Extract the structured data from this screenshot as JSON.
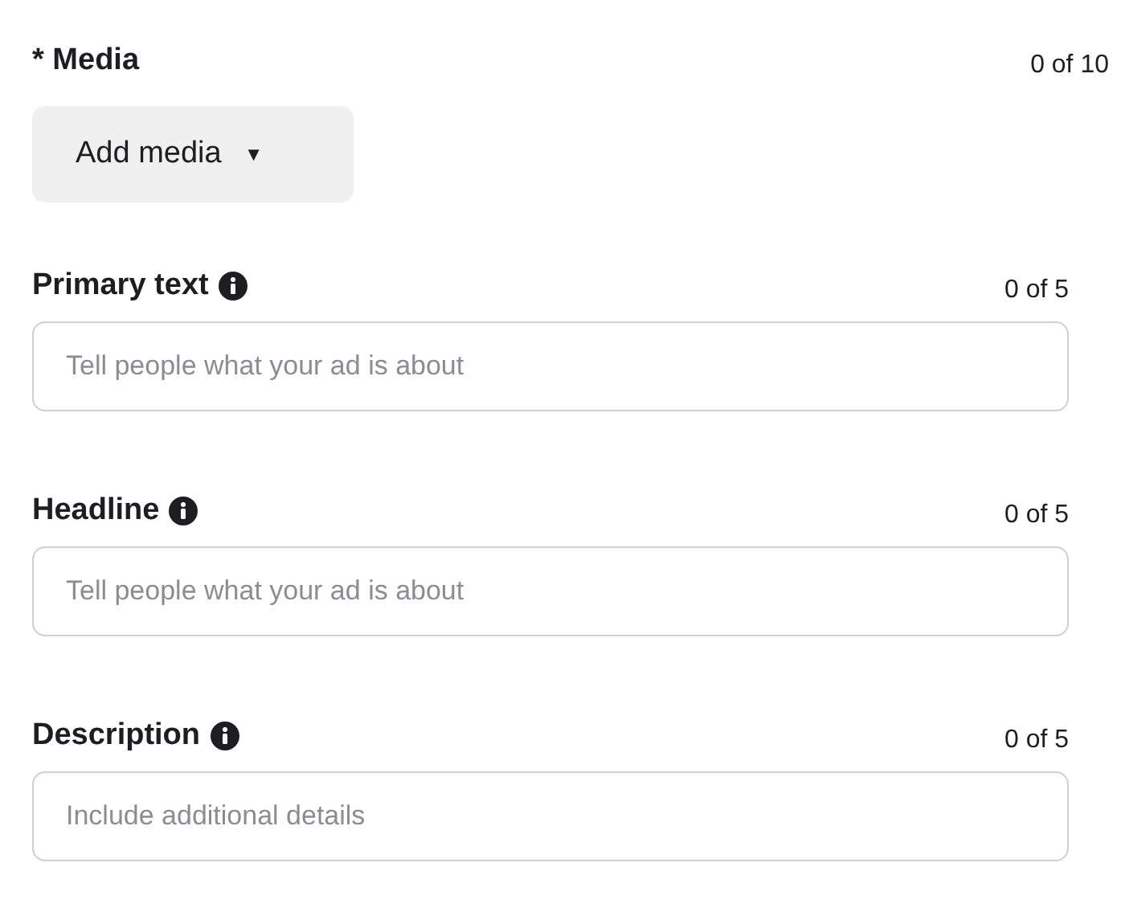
{
  "media": {
    "label": "* Media",
    "count": "0 of 10",
    "button": {
      "label": "Add media",
      "caret": "▼"
    }
  },
  "fields": [
    {
      "label": "Primary text",
      "count": "0 of 5",
      "placeholder": "Tell people what your ad is about"
    },
    {
      "label": "Headline",
      "count": "0 of 5",
      "placeholder": "Tell people what your ad is about"
    },
    {
      "label": "Description",
      "count": "0 of 5",
      "placeholder": "Include additional details"
    }
  ]
}
